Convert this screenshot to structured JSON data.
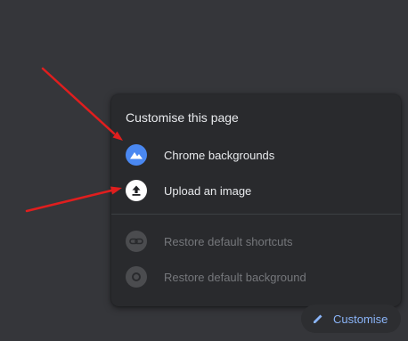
{
  "menu": {
    "title": "Customise this page",
    "items": [
      {
        "label": "Chrome backgrounds",
        "icon": "chrome-backgrounds-icon",
        "enabled": true
      },
      {
        "label": "Upload an image",
        "icon": "upload-icon",
        "enabled": true
      },
      {
        "label": "Restore default shortcuts",
        "icon": "link-icon",
        "enabled": false
      },
      {
        "label": "Restore default background",
        "icon": "chrome-logo-icon",
        "enabled": false
      }
    ]
  },
  "customise_button": {
    "label": "Customise",
    "icon": "pencil-icon"
  },
  "colors": {
    "page_background": "#35363a",
    "menu_background": "#292a2d",
    "text": "#e8eaed",
    "disabled_text": "#75777b",
    "accent": "#8ab4f8",
    "icon_blue": "#4a88f1",
    "annotation_arrow": "#e01e1e"
  }
}
